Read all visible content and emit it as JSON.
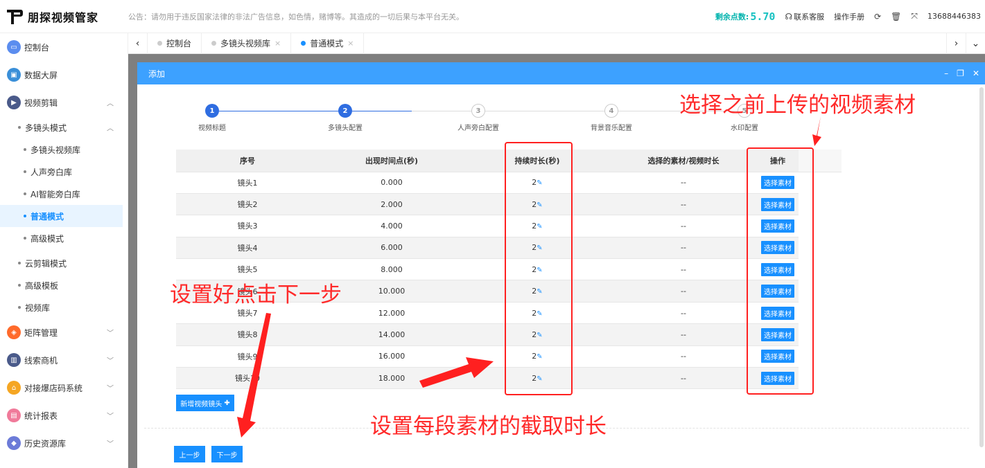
{
  "header": {
    "logo_text": "朋探视频管家",
    "notice": "公告：请勿用于违反国家法律的非法广告信息，如色情，赌博等。其造成的一切后果与本平台无关。",
    "points_label": "剩余点数:",
    "points_value": "5.70",
    "contact": "联系客服",
    "manual": "操作手册",
    "user": "13688446383"
  },
  "sidebar": {
    "dashboard": "控制台",
    "bigscreen": "数据大屏",
    "video_edit": "视频剪辑",
    "multi_mode": "多镜头模式",
    "multi_lib": "多镜头视频库",
    "voice_lib": "人声旁白库",
    "ai_lib": "AI智能旁白库",
    "normal_mode": "普通模式",
    "advanced_mode": "高级模式",
    "cloud_mode": "云剪辑模式",
    "advanced_tpl": "高级模板",
    "video_lib": "视频库",
    "matrix": "矩阵管理",
    "leads": "线索商机",
    "store": "对接爆店码系统",
    "stats": "统计报表",
    "history": "历史资源库"
  },
  "tabs": [
    {
      "label": "控制台"
    },
    {
      "label": "多镜头视频库"
    },
    {
      "label": "普通模式"
    }
  ],
  "dialog": {
    "title": "添加",
    "steps": [
      "视频标题",
      "多镜头配置",
      "人声旁白配置",
      "背景音乐配置",
      "水印配置"
    ],
    "columns": [
      "序号",
      "出现时间点(秒)",
      "持续时长(秒)",
      "选择的素材/视频时长",
      "操作"
    ],
    "rows": [
      {
        "no": "镜头1",
        "time": "0.000",
        "dur": "2",
        "mat": "--",
        "btn": "选择素材"
      },
      {
        "no": "镜头2",
        "time": "2.000",
        "dur": "2",
        "mat": "--",
        "btn": "选择素材"
      },
      {
        "no": "镜头3",
        "time": "4.000",
        "dur": "2",
        "mat": "--",
        "btn": "选择素材"
      },
      {
        "no": "镜头4",
        "time": "6.000",
        "dur": "2",
        "mat": "--",
        "btn": "选择素材"
      },
      {
        "no": "镜头5",
        "time": "8.000",
        "dur": "2",
        "mat": "--",
        "btn": "选择素材"
      },
      {
        "no": "镜头6",
        "time": "10.000",
        "dur": "2",
        "mat": "--",
        "btn": "选择素材"
      },
      {
        "no": "镜头7",
        "time": "12.000",
        "dur": "2",
        "mat": "--",
        "btn": "选择素材"
      },
      {
        "no": "镜头8",
        "time": "14.000",
        "dur": "2",
        "mat": "--",
        "btn": "选择素材"
      },
      {
        "no": "镜头9",
        "time": "16.000",
        "dur": "2",
        "mat": "--",
        "btn": "选择素材"
      },
      {
        "no": "镜头10",
        "time": "18.000",
        "dur": "2",
        "mat": "--",
        "btn": "选择素材"
      }
    ],
    "add_btn": "新增视频镜头",
    "prev_btn": "上一步",
    "next_btn": "下一步"
  },
  "annotations": {
    "choose": "选择之前上传的视频素材",
    "next": "设置好点击下一步",
    "duration": "设置每段素材的截取时长"
  },
  "colors": {
    "primary": "#1890ff",
    "header_blue": "#3da1ff",
    "annotation_red": "#ff2020",
    "points_teal": "#19c2c2"
  }
}
